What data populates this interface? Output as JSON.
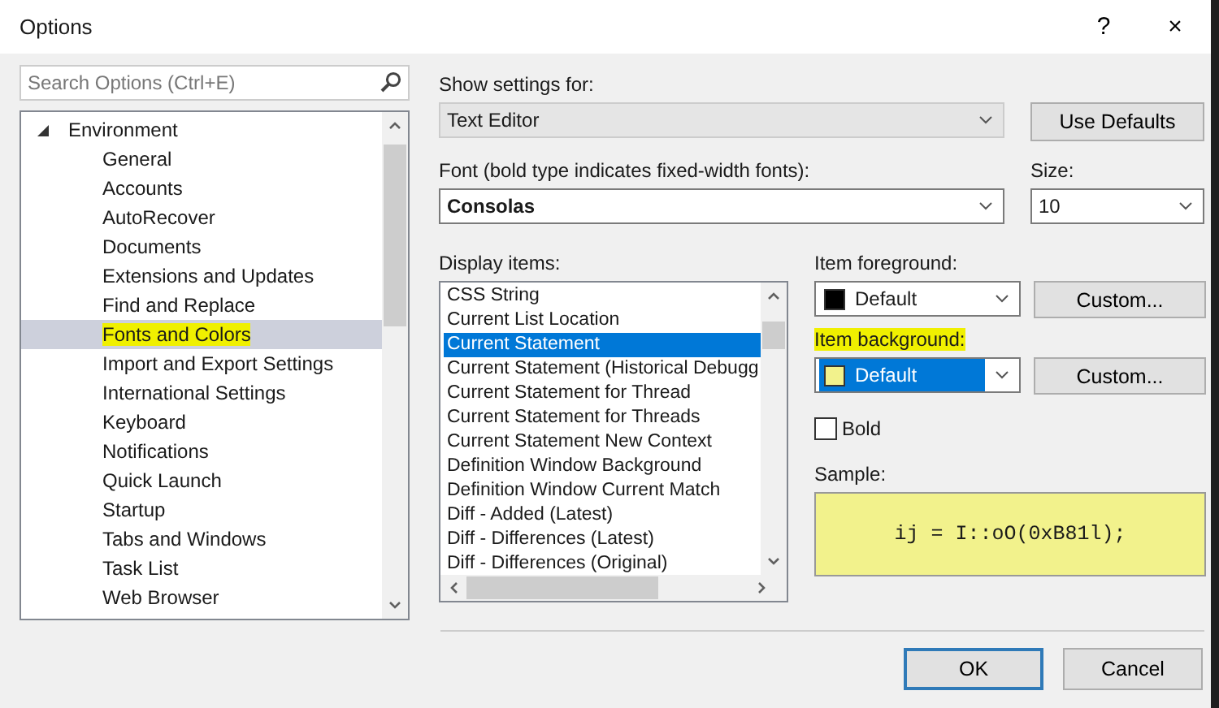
{
  "window": {
    "title": "Options",
    "help": "?",
    "close": "×"
  },
  "search": {
    "placeholder": "Search Options (Ctrl+E)"
  },
  "tree": [
    {
      "label": "Environment",
      "expanded": true,
      "selected": false,
      "marked": false,
      "children": [
        {
          "label": "General",
          "selected": false,
          "marked": false
        },
        {
          "label": "Accounts",
          "selected": false,
          "marked": false
        },
        {
          "label": "AutoRecover",
          "selected": false,
          "marked": false
        },
        {
          "label": "Documents",
          "selected": false,
          "marked": false
        },
        {
          "label": "Extensions and Updates",
          "selected": false,
          "marked": false
        },
        {
          "label": "Find and Replace",
          "selected": false,
          "marked": false
        },
        {
          "label": "Fonts and Colors",
          "selected": true,
          "marked": true
        },
        {
          "label": "Import and Export Settings",
          "selected": false,
          "marked": false
        },
        {
          "label": "International Settings",
          "selected": false,
          "marked": false
        },
        {
          "label": "Keyboard",
          "selected": false,
          "marked": false
        },
        {
          "label": "Notifications",
          "selected": false,
          "marked": false
        },
        {
          "label": "Quick Launch",
          "selected": false,
          "marked": false
        },
        {
          "label": "Startup",
          "selected": false,
          "marked": false
        },
        {
          "label": "Tabs and Windows",
          "selected": false,
          "marked": false
        },
        {
          "label": "Task List",
          "selected": false,
          "marked": false
        },
        {
          "label": "Web Browser",
          "selected": false,
          "marked": false
        }
      ]
    }
  ],
  "show_settings_for": {
    "label": "Show settings for:",
    "value": "Text Editor",
    "disabled": true
  },
  "use_defaults": "Use Defaults",
  "font": {
    "label": "Font (bold type indicates fixed-width fonts):",
    "value": "Consolas"
  },
  "size": {
    "label": "Size:",
    "value": "10"
  },
  "display_items": {
    "label": "Display items:",
    "items": [
      {
        "label": "CSS String",
        "selected": false
      },
      {
        "label": "Current List Location",
        "selected": false
      },
      {
        "label": "Current Statement",
        "selected": true
      },
      {
        "label": "Current Statement (Historical Debugg",
        "selected": false
      },
      {
        "label": "Current Statement for Thread",
        "selected": false
      },
      {
        "label": "Current Statement for Threads",
        "selected": false
      },
      {
        "label": "Current Statement New Context",
        "selected": false
      },
      {
        "label": "Definition Window Background",
        "selected": false
      },
      {
        "label": "Definition Window Current Match",
        "selected": false
      },
      {
        "label": "Diff - Added (Latest)",
        "selected": false
      },
      {
        "label": "Diff - Differences (Latest)",
        "selected": false
      },
      {
        "label": "Diff - Differences (Original)",
        "selected": false
      }
    ]
  },
  "colors": [
    {
      "label": "Item foreground:",
      "value": "Default",
      "color": "#000000",
      "marked": false,
      "focused": false,
      "button": "Custom..."
    },
    {
      "label": "Item background:",
      "value": "Default",
      "color": "#f2f28c",
      "marked": true,
      "focused": true,
      "button": "Custom..."
    }
  ],
  "bold": {
    "label": "Bold",
    "checked": false
  },
  "sample": {
    "label": "Sample:",
    "text": "ij = I::oO(0xB81l);"
  },
  "buttons": [
    {
      "label": "OK",
      "default": true
    },
    {
      "label": "Cancel",
      "default": false
    }
  ]
}
